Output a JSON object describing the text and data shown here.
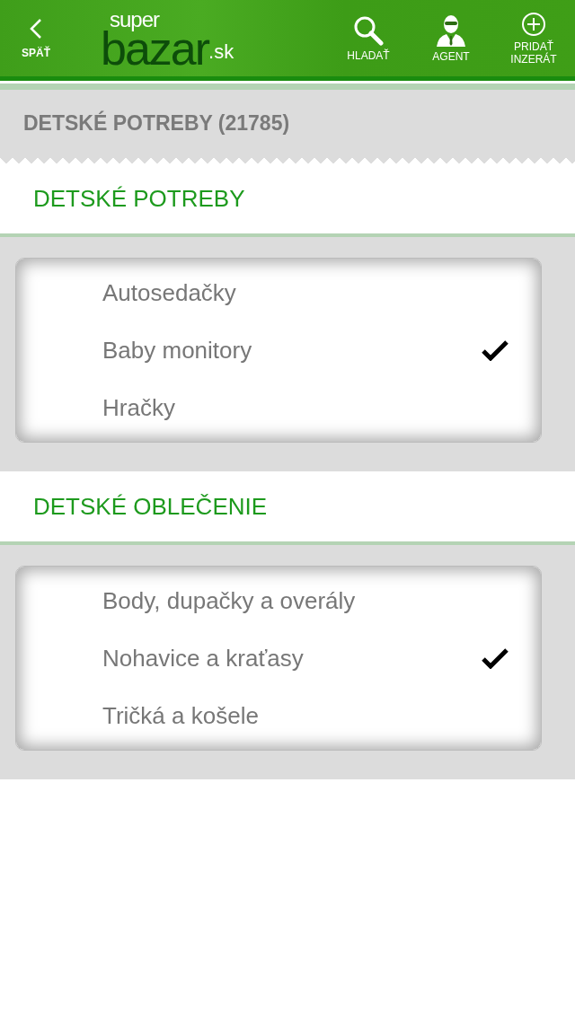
{
  "header": {
    "back": "SPÄŤ",
    "logo": {
      "top": "super",
      "main": "bazar",
      "suffix": ".sk"
    },
    "actions": [
      {
        "kind": "search",
        "label": "HLADAŤ"
      },
      {
        "kind": "agent",
        "label": "AGENT"
      },
      {
        "kind": "add",
        "label": "PRIDAŤ INZERÁT"
      }
    ]
  },
  "page_title": "DETSKÉ POTREBY (21785)",
  "sections": [
    {
      "title": "DETSKÉ POTREBY",
      "items": [
        {
          "label": "Autosedačky",
          "selected": false
        },
        {
          "label": "Baby monitory",
          "selected": true
        },
        {
          "label": "Hračky",
          "selected": false
        }
      ]
    },
    {
      "title": "DETSKÉ OBLEČENIE",
      "items": [
        {
          "label": "Body, dupačky a overály",
          "selected": false
        },
        {
          "label": "Nohavice a kraťasy",
          "selected": true
        },
        {
          "label": "Tričká a košele",
          "selected": false
        }
      ]
    }
  ]
}
